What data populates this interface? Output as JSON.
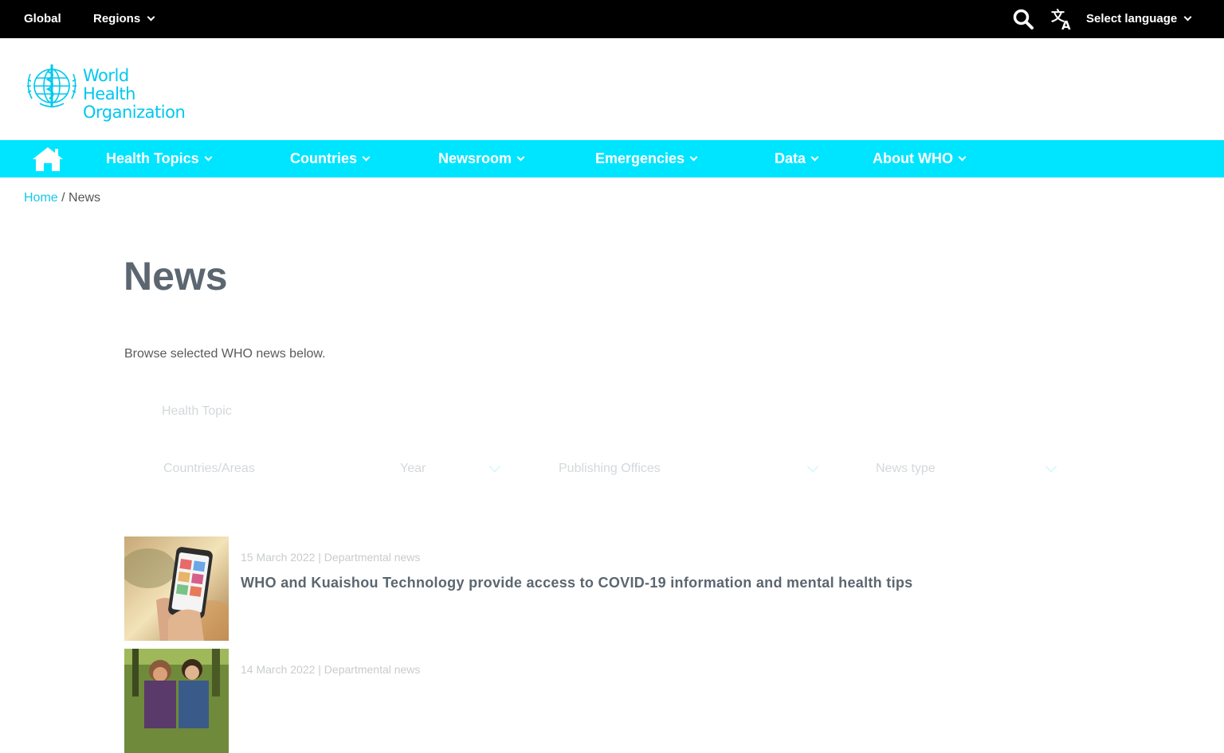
{
  "topbar": {
    "global": "Global",
    "regions": "Regions",
    "language": "Select language"
  },
  "logo": {
    "line1": "World Health",
    "line2": "Organization"
  },
  "nav": {
    "items": [
      {
        "label": "Health Topics"
      },
      {
        "label": "Countries"
      },
      {
        "label": "Newsroom"
      },
      {
        "label": "Emergencies"
      },
      {
        "label": "Data"
      },
      {
        "label": "About WHO"
      }
    ]
  },
  "breadcrumb": {
    "home": "Home",
    "separator": " / ",
    "current": "News"
  },
  "page": {
    "title": "News",
    "intro": "Browse selected WHO news below."
  },
  "filters": {
    "health_topic": "Health Topic",
    "countries": "Countries/Areas",
    "year": "Year",
    "offices": "Publishing Offices",
    "news_type": "News type"
  },
  "news": [
    {
      "meta": "15 March 2022 | Departmental news",
      "title": "WHO and Kuaishou Technology provide access to COVID-19 information and mental health tips"
    },
    {
      "meta": "14 March 2022 | Departmental news",
      "title": ""
    }
  ],
  "colors": {
    "accent": "#00e5ff",
    "link": "#17c8ea",
    "title": "#5b6670"
  }
}
